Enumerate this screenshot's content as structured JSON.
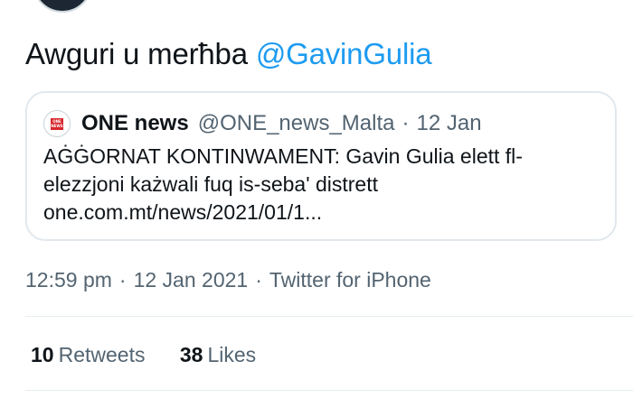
{
  "tweet": {
    "text_prefix": "Awguri u merħba ",
    "mention": "@GavinGulia"
  },
  "quote": {
    "logo_text_top": "ONE",
    "logo_text_bottom": "NEWS",
    "name": "ONE news",
    "handle": "@ONE_news_Malta",
    "separator": "·",
    "date": "12 Jan",
    "body_lines": [
      "AĠĠORNAT KONTINWAMENT: Gavin Gulia elett fl-",
      "elezzjoni każwali fuq is-seba' distrett",
      "one.com.mt/news/2021/01/1..."
    ]
  },
  "meta": {
    "time": "12:59 pm",
    "separator": "·",
    "date": "12 Jan 2021",
    "source": "Twitter for iPhone"
  },
  "stats": {
    "retweets_count": "10",
    "retweets_label": "Retweets",
    "likes_count": "38",
    "likes_label": "Likes"
  }
}
